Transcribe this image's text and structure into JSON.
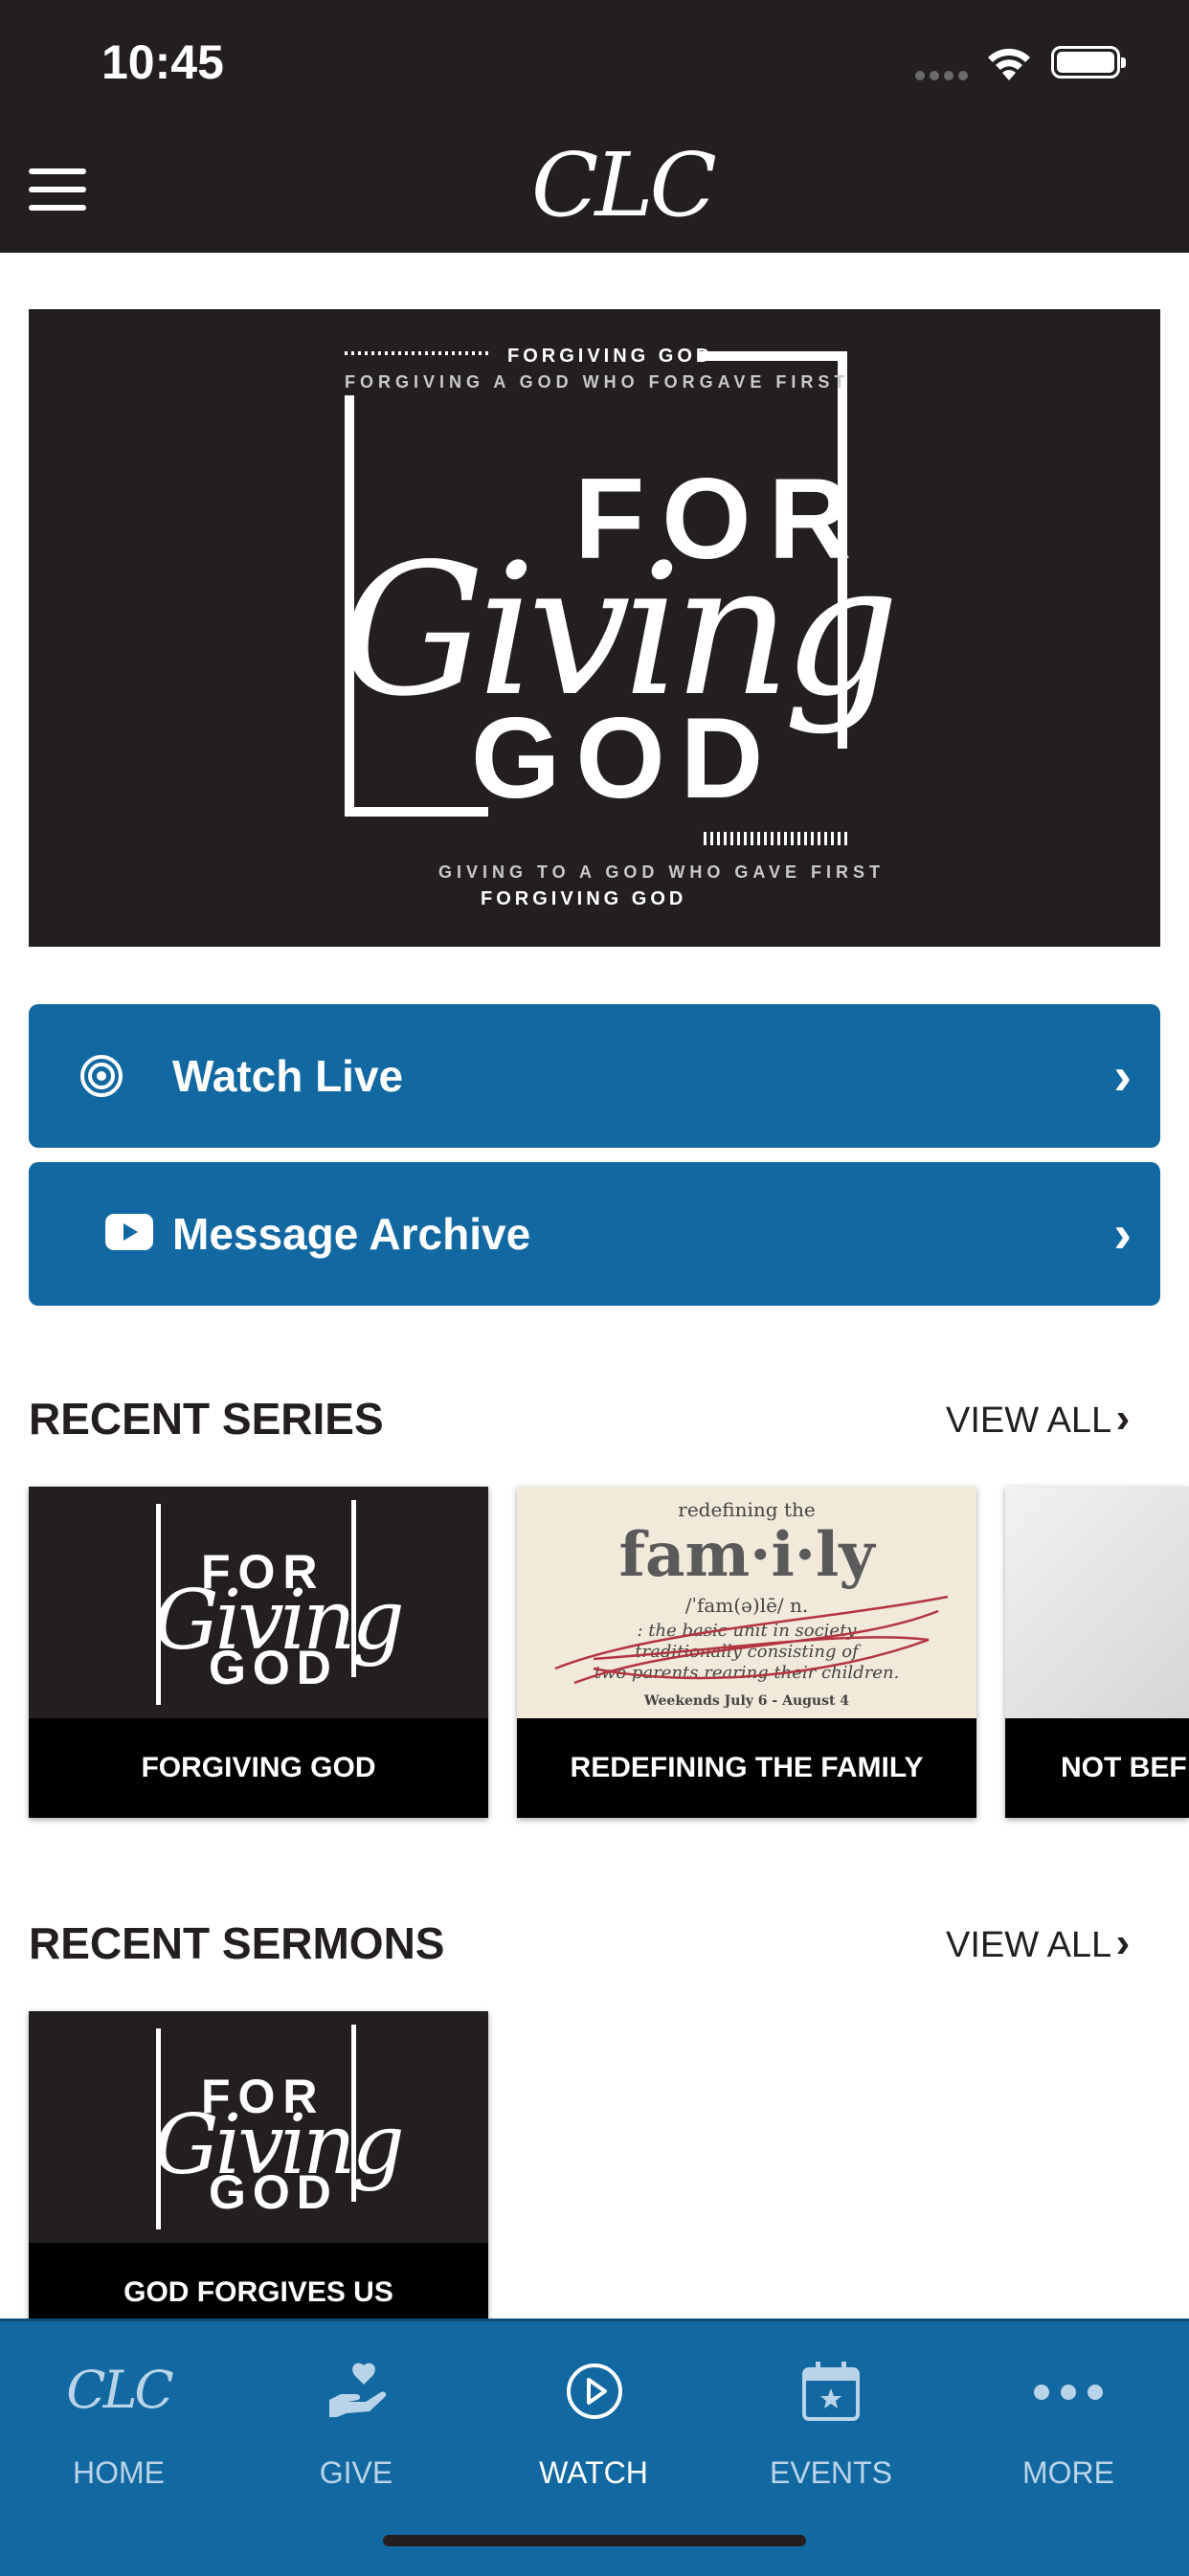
{
  "status_bar": {
    "time": "10:45"
  },
  "header": {
    "logo_text": "CLC"
  },
  "hero": {
    "top_label": "FORGIVING GOD",
    "top_sub": "FORGIVING A GOD WHO FORGAVE FIRST",
    "word_for": "FOR",
    "word_giving": "Giving",
    "word_god": "GOD",
    "bottom_sub": "GIVING TO A GOD WHO GAVE FIRST",
    "bottom_label": "FORGIVING GOD"
  },
  "actions": {
    "watch_live": "Watch Live",
    "message_archive": "Message Archive"
  },
  "recent_series": {
    "title": "RECENT SERIES",
    "view_all": "VIEW ALL",
    "items": [
      {
        "caption": "FORGIVING GOD"
      },
      {
        "caption": "REDEFINING THE FAMILY",
        "art_top": "redefining the",
        "art_word": "fam·i·ly",
        "art_pron": "/ˈfam(ə)lē/ n.",
        "art_def1": ": the basic unit in society",
        "art_def2": "traditionally consisting of",
        "art_def3": "two parents rearing their children.",
        "art_dates": "Weekends July 6 - August 4"
      },
      {
        "caption": "NOT BEF"
      }
    ]
  },
  "recent_sermons": {
    "title": "RECENT SERMONS",
    "view_all": "VIEW ALL",
    "items": [
      {
        "caption": "GOD FORGIVES US"
      }
    ]
  },
  "tabbar": {
    "home": "HOME",
    "give": "GIVE",
    "watch": "WATCH",
    "events": "EVENTS",
    "more": "MORE"
  },
  "colors": {
    "brand_blue": "#1268a0",
    "dark": "#231f20"
  }
}
